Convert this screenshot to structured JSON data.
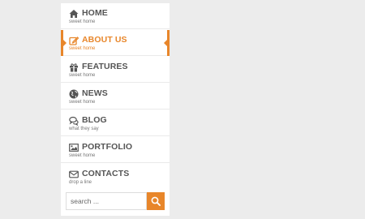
{
  "menu": {
    "items": [
      {
        "label": "HOME",
        "sub": "sweet home",
        "icon": "home-icon"
      },
      {
        "label": "ABOUT US",
        "sub": "sweet home",
        "icon": "edit-icon"
      },
      {
        "label": "FEATURES",
        "sub": "sweet home",
        "icon": "gift-icon"
      },
      {
        "label": "NEWS",
        "sub": "sweet home",
        "icon": "globe-icon"
      },
      {
        "label": "BLOG",
        "sub": "what they say",
        "icon": "comments-icon"
      },
      {
        "label": "PORTFOLIO",
        "sub": "sweet home",
        "icon": "picture-icon"
      },
      {
        "label": "CONTACTS",
        "sub": "drop a line",
        "icon": "envelope-icon"
      }
    ],
    "active_item": "ABOUT US"
  },
  "search": {
    "placeholder": "search ...",
    "button_icon": "search-icon"
  },
  "colors": {
    "accent": "#e8862a",
    "text": "#555555",
    "background": "#ececec",
    "panel": "#ffffff"
  }
}
